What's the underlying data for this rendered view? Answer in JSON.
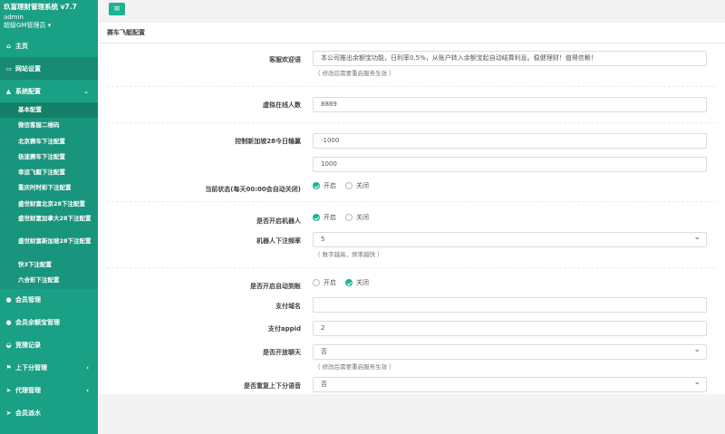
{
  "sidebar": {
    "brand": "玖富理财管理系统 v7.7",
    "user_name": "admin",
    "user_role": "超级GM管理员",
    "items": [
      {
        "label": "主页",
        "icon": "home-icon"
      },
      {
        "label": "网站设置",
        "icon": "window-icon"
      },
      {
        "label": "系统配置",
        "icon": "flask-icon"
      }
    ],
    "subitems": [
      "基本配置",
      "微信客服二维码",
      "北京赛车下注配置",
      "极速赛车下注配置",
      "幸运飞艇下注配置",
      "重庆时时彩下注配置",
      "盛世财富北京28下注配置",
      "盛世财富加拿大28下注配置",
      "盛世财富新加坡28下注配置",
      "快3下注配置",
      "六合彩下注配置"
    ],
    "bottom_items": [
      {
        "label": "会员管理",
        "icon": "user-icon"
      },
      {
        "label": "会员余额宝管理",
        "icon": "user-icon"
      },
      {
        "label": "竞猜记录",
        "icon": "car-icon"
      },
      {
        "label": "上下分管理",
        "icon": "flag-icon"
      },
      {
        "label": "代理管理",
        "icon": "send-icon"
      },
      {
        "label": "会员派水",
        "icon": "send-icon"
      }
    ]
  },
  "topbar": {
    "menu_icon": "bars-icon"
  },
  "panel": {
    "title": "赛车飞艇配置",
    "welcome_label": "客服欢迎语",
    "welcome_value": "本公司推出余额宝功能，日利率0.5%，从账户转入余额宝起自动结算利息。稳健理财！值得信赖！",
    "restart_hint": "（ 修改后需要重启服务生效 ）",
    "online_label": "虚拟在线人数",
    "online_value": "8889",
    "sg28_label": "控制新加坡28今日输赢",
    "sg28_min": "-1000",
    "sg28_max": "1000",
    "state_label": "当前状态(每天00:00会自动关闭)",
    "on_label": "开启",
    "off_label": "关闭",
    "robot_label": "是否开启机器人",
    "robot_freq_label": "机器人下注频率",
    "robot_freq_value": "5",
    "robot_freq_hint": "（ 数字越高，频率越快 ）",
    "auto_label": "是否开启自动到账",
    "domain_label": "支付域名",
    "domain_value": "",
    "appid_label": "支付appid",
    "appid_value": "2",
    "chat_label": "是否开放聊天",
    "chat_value": "否",
    "chat_hint": "（ 修改后需要重启服务生效 ）",
    "voice_label": "是否重复上下分语音",
    "voice_value": "否"
  }
}
